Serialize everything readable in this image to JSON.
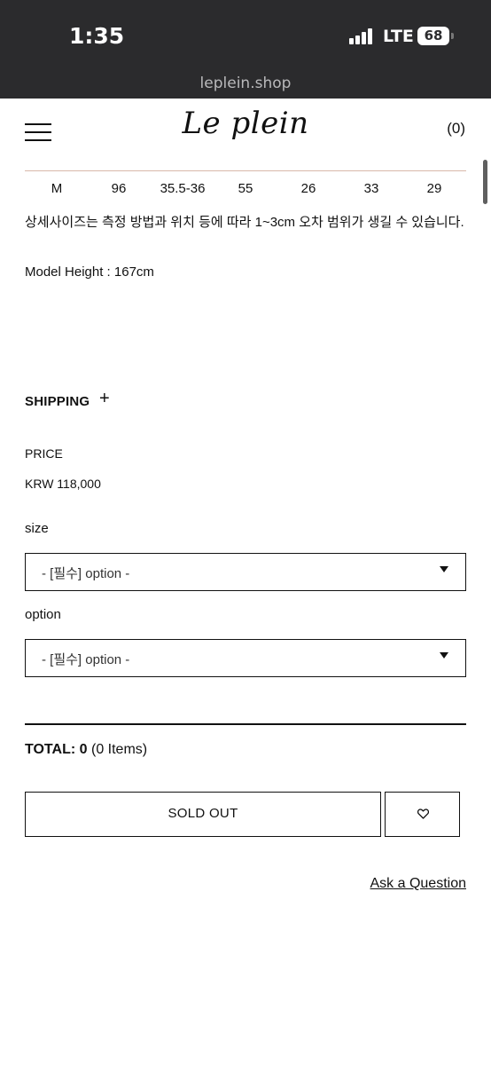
{
  "status_bar": {
    "time": "1:35",
    "network": "LTE",
    "battery": "68"
  },
  "browser": {
    "url": "leplein.shop"
  },
  "header": {
    "logo": "Le plein",
    "cart": "(0)"
  },
  "size_table": {
    "row": [
      "M",
      "96",
      "35.5-36",
      "55",
      "26",
      "33",
      "29"
    ]
  },
  "product": {
    "size_note": "상세사이즈는 측정 방법과 위치 등에 따라 1~3cm 오차 범위가 생길 수 있습니다.",
    "model_height": "Model Height : 167cm",
    "shipping_label": "SHIPPING",
    "shipping_toggle": "+",
    "price_label": "PRICE",
    "price_value": "KRW 118,000"
  },
  "options": {
    "size_label": "size",
    "size_value": "- [필수] option -",
    "option_label": "option",
    "option_value": "- [필수] option -"
  },
  "total": {
    "label": "TOTAL:",
    "amount": "0",
    "items": "(0 Items)"
  },
  "actions": {
    "sold_out": "SOLD OUT",
    "wishlist_icon": "heart-icon",
    "ask_question": "Ask a Question"
  },
  "colors": {
    "status_bar_bg": "#2b2b2d",
    "table_line": "#d8b8a9"
  }
}
